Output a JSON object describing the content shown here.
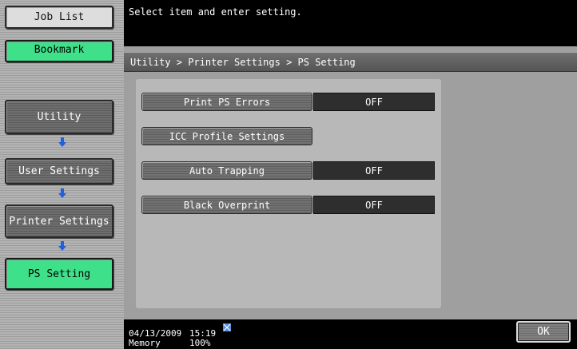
{
  "sidebar": {
    "job_list": "Job List",
    "bookmark": "Bookmark",
    "utility": "Utility",
    "user_settings": "User Settings",
    "printer_settings": "Printer Settings",
    "ps_setting": "PS Setting"
  },
  "header": {
    "message": "Select item and enter setting."
  },
  "breadcrumb": "Utility > Printer Settings > PS Setting",
  "settings": [
    {
      "label": "Print PS Errors",
      "value": "OFF"
    },
    {
      "label": "ICC Profile Settings",
      "value": ""
    },
    {
      "label": "Auto Trapping",
      "value": "OFF"
    },
    {
      "label": "Black Overprint",
      "value": "OFF"
    }
  ],
  "status": {
    "date": "04/13/2009",
    "time": "15:19",
    "memory_label": "Memory",
    "memory_value": "100%",
    "ok_label": "OK",
    "icon": "network-icon"
  },
  "colors": {
    "accent_green": "#3ee08a",
    "arrow_blue": "#1f5fe0"
  }
}
